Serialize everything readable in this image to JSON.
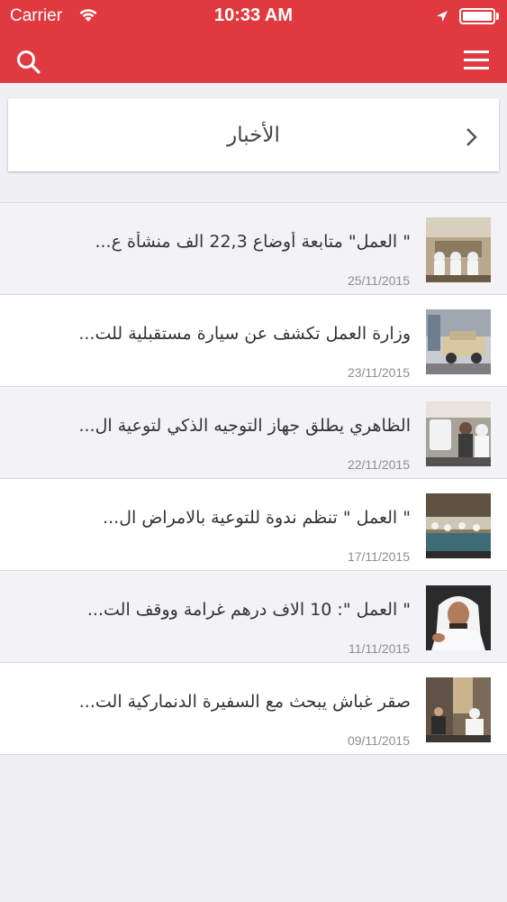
{
  "status_bar": {
    "carrier": "Carrier",
    "time": "10:33 AM"
  },
  "header": {
    "search_icon": "search-icon",
    "menu_icon": "hamburger-menu-icon",
    "color": "#e0393f"
  },
  "section": {
    "title": "الأخبار",
    "chevron_icon": "chevron-icon"
  },
  "news": [
    {
      "title": "\" العمل\" متابعة أوضاع 22,3 الف منشأة ع...",
      "date": "25/11/2015",
      "thumb": "meeting-room-photo"
    },
    {
      "title": "وزارة العمل تكشف عن سيارة مستقبلية للت...",
      "date": "23/11/2015",
      "thumb": "car-photo"
    },
    {
      "title": "الظاهري يطلق جهاز التوجيه الذكي لتوعية ال...",
      "date": "22/11/2015",
      "thumb": "crowd-photo"
    },
    {
      "title": "\" العمل \" تنظم ندوة للتوعية بالامراض ال...",
      "date": "17/11/2015",
      "thumb": "seminar-photo"
    },
    {
      "title": "\" العمل \": 10 الاف درهم غرامة ووقف الت...",
      "date": "11/11/2015",
      "thumb": "portrait-photo"
    },
    {
      "title": "صقر غباش يبحث مع السفيرة الدنماركية الت...",
      "date": "09/11/2015",
      "thumb": "office-meeting-photo"
    }
  ]
}
